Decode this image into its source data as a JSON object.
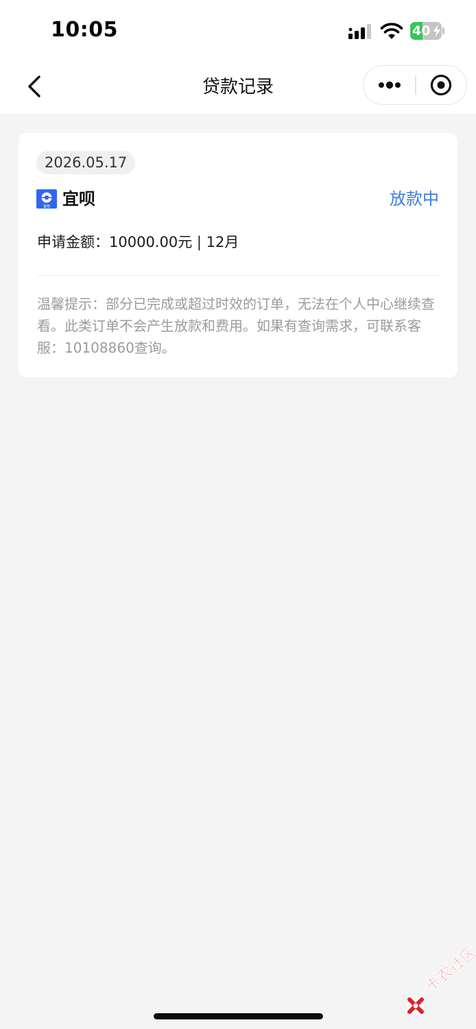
{
  "status_bar": {
    "time": "10:05",
    "battery": "40",
    "battery_level": 0.4
  },
  "nav": {
    "title": "贷款记录"
  },
  "record": {
    "date": "2026.05.17",
    "brand_name": "宜呗",
    "brand_logo_caption": "宜呗",
    "status": "放款中",
    "apply_line": "申请金额：10000.00元 | 12月",
    "tip": "温馨提示：部分已完成或超过时效的订单，无法在个人中心继续查看。此类订单不会产生放款和费用。如果有查询需求，可联系客服：10108860查询。"
  },
  "watermark": {
    "text": "卡农社区"
  },
  "colors": {
    "accent": "#3b7ddd",
    "background": "#f4f4f4",
    "battery_green": "#34c759",
    "brand_blue": "#2f66f2",
    "watermark_red": "#d8232a"
  }
}
